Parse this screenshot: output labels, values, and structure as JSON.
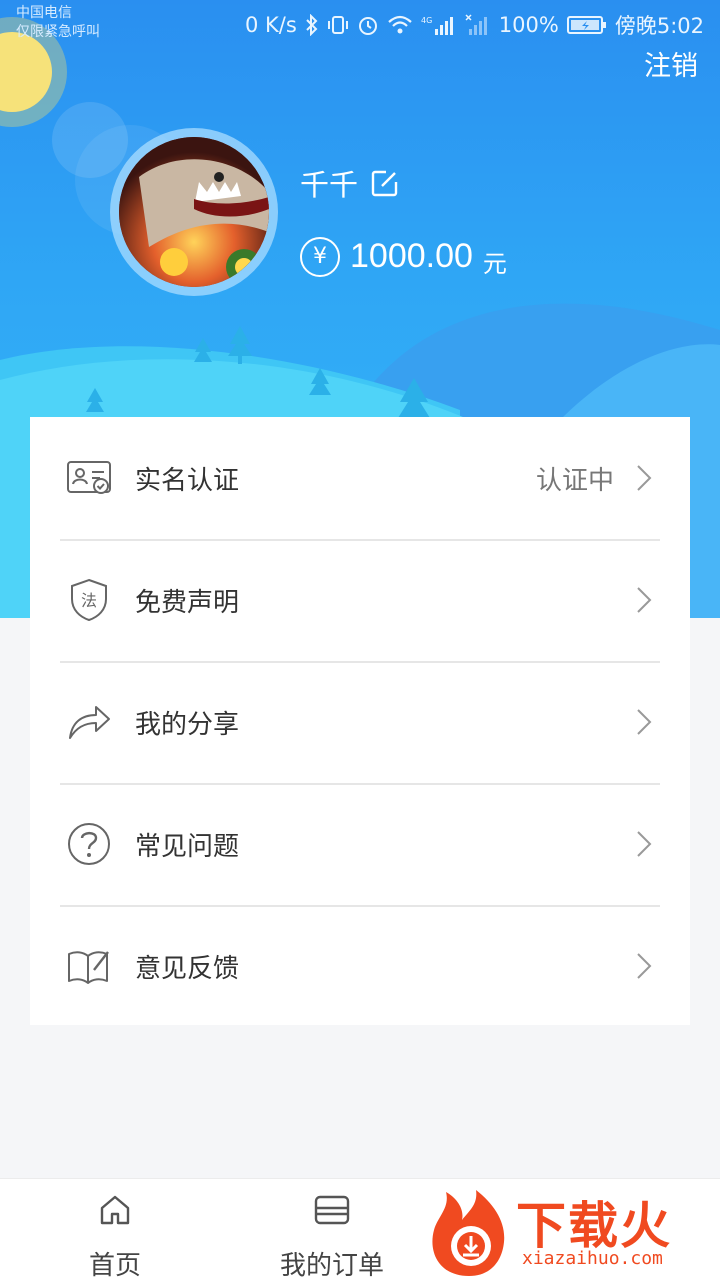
{
  "statusbar": {
    "carrier_line1": "中国电信",
    "carrier_line2": "仅限紧急呼叫",
    "net_speed": "0 K/s",
    "battery": "100%",
    "time": "傍晚5:02"
  },
  "header": {
    "logout_label": "注销",
    "username": "千千",
    "currency_symbol": "¥",
    "balance": "1000.00",
    "balance_unit": "元"
  },
  "menu": {
    "items": [
      {
        "label": "实名认证",
        "status": "认证中",
        "icon": "id-card-icon"
      },
      {
        "label": "免费声明",
        "status": "",
        "icon": "law-shield-icon",
        "icon_text": "法"
      },
      {
        "label": "我的分享",
        "status": "",
        "icon": "share-arrow-icon"
      },
      {
        "label": "常见问题",
        "status": "",
        "icon": "question-icon"
      },
      {
        "label": "意见反馈",
        "status": "",
        "icon": "feedback-book-icon"
      }
    ]
  },
  "tabbar": {
    "tabs": [
      {
        "label": "首页",
        "icon": "home-icon"
      },
      {
        "label": "我的订单",
        "icon": "order-icon"
      }
    ]
  },
  "watermark": {
    "title": "下载火",
    "subtitle": "xiazaihuo.com"
  },
  "colors": {
    "header_blue": "#2a8ff0",
    "hill_light": "#4cd3f7",
    "text_primary": "#333333",
    "text_secondary": "#777777",
    "watermark_orange": "#f04a20"
  }
}
